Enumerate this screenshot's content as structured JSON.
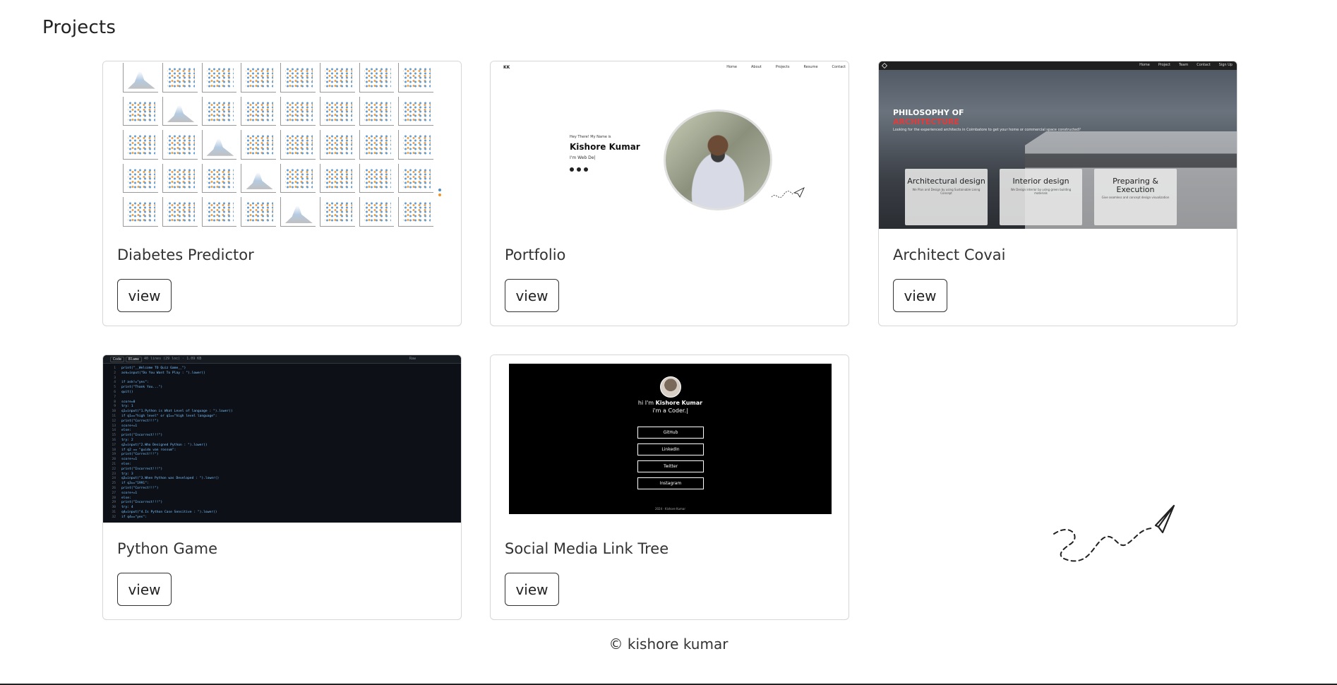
{
  "page": {
    "title": "Projects"
  },
  "projects": [
    {
      "title": "Diabetes Predictor",
      "button": "view"
    },
    {
      "title": "Portfolio",
      "button": "view",
      "preview": {
        "logo": "KK",
        "nav": [
          "Home",
          "About",
          "Projects",
          "Resume",
          "Contact"
        ],
        "greeting": "Hey There! My Name is",
        "name": "Kishore Kumar",
        "role": "I'm Web De|"
      }
    },
    {
      "title": "Architect Covai",
      "button": "view",
      "preview": {
        "nav": [
          "Home",
          "Project",
          "Team",
          "Contact",
          "Sign Up"
        ],
        "heading1": "PHILOSOPHY OF",
        "heading2": "ARCHITECTURE",
        "subtitle": "Looking for the experienced architects in Coimbatore to get your home or commercial space constructed?",
        "services": [
          {
            "title": "Architectural design",
            "text": "We Plan and Design by using Sustainable Living Concept"
          },
          {
            "title": "Interior design",
            "text": "We Design interior by using green building materials"
          },
          {
            "title": "Preparing & Execution",
            "text": "Give seamless and concept design visualization"
          }
        ]
      }
    },
    {
      "title": "Python Game",
      "button": "view",
      "preview": {
        "tabs": [
          "Code",
          "Blame"
        ],
        "meta": "40 lines (29 loc) · 1.09 KB",
        "raw": "Raw",
        "lines": [
          "print(\"__Welcome TO Quiz Game__\")",
          "ask=input(\"Do You Want To Play : \").lower()",
          "",
          "if ask!=\"yes\":",
          "    print(\"Thank You...\")",
          "    quit()",
          "",
          "score=0",
          "try: 1",
          "q1=input(\"1.Python is What Level of language : \").lower()",
          "if q1==\"high level\" or q1==\"high level language\":",
          "    print(\"Correct!!!\")",
          "    score+=1",
          "else:",
          "    print(\"Incorrect!!!\")",
          "try: 2",
          "q2=input(\"2.Who Designed Python : \").lower()",
          "if q2 == \"guido van rossum\":",
          "    print(\"Correct!!!\")",
          "    score+=1",
          "else:",
          "    print(\"Incorrect!!!\")",
          "try: 3",
          "q3=input(\"3.When Python was Developed : \").lower()",
          "if q3==\"1991\":",
          "    print(\"Correct!!!\")",
          "    score+=1",
          "else:",
          "    print(\"Incorrect!!!\")",
          "try: 4",
          "q4=input(\"4.Is Python Case Sensitive : \").lower()",
          "if q4==\"yes\":"
        ]
      }
    },
    {
      "title": "Social Media Link Tree",
      "button": "view",
      "preview": {
        "hi_prefix": "hi I'm",
        "name": "Kishore Kumar",
        "im": "i'm a Coder.|",
        "links": [
          "GitHub",
          "LinkedIn",
          "Twitter",
          "Instagram"
        ],
        "footer": "2024 · Kishore Kumar"
      }
    }
  ],
  "footer": {
    "text": "© kishore kumar"
  }
}
